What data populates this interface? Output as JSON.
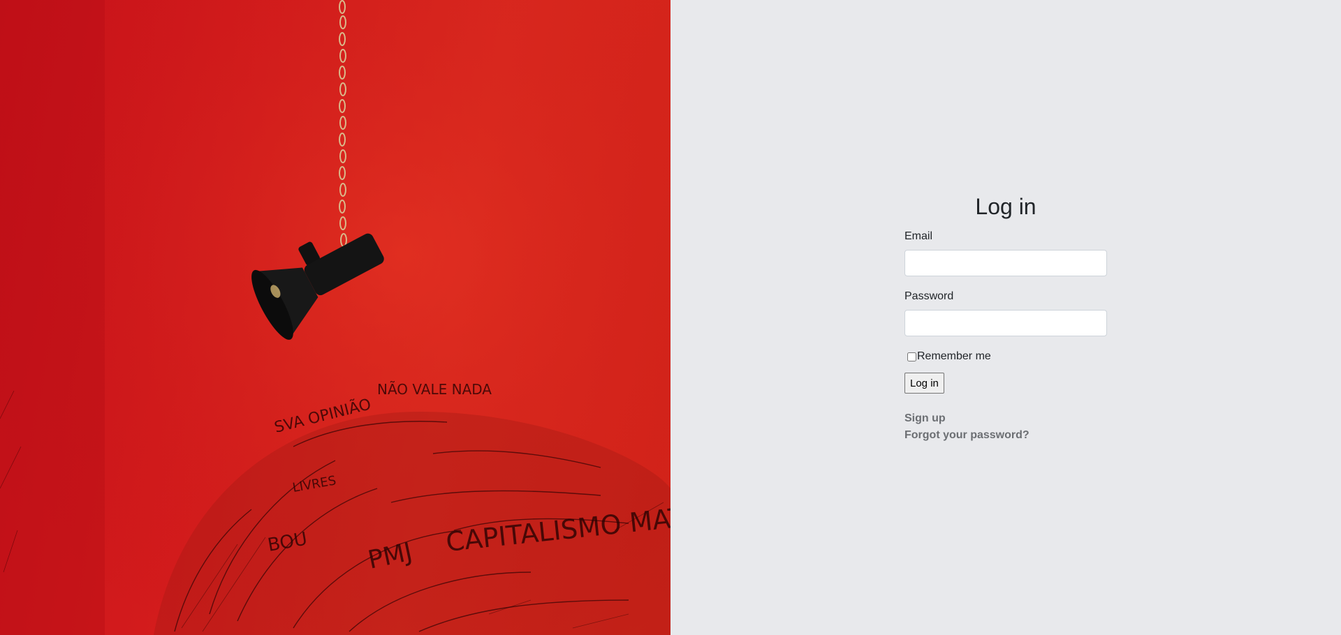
{
  "hero": {
    "image_description_icon": "megaphone-icon",
    "wall_text": [
      "SUA OPINIÃO NÃO VALE NADA",
      "CAPITALISMO MATA",
      "PMJ",
      "LIVRES"
    ]
  },
  "login": {
    "title": "Log in",
    "email_label": "Email",
    "email_value": "",
    "password_label": "Password",
    "password_value": "",
    "remember_label": "Remember me",
    "remember_checked": false,
    "submit_label": "Log in",
    "signup_link": "Sign up",
    "forgot_link": "Forgot your password?"
  },
  "colors": {
    "hero_red": "#d41c1c",
    "panel_bg": "#e8e9ec",
    "link_gray": "#6c6f73"
  }
}
